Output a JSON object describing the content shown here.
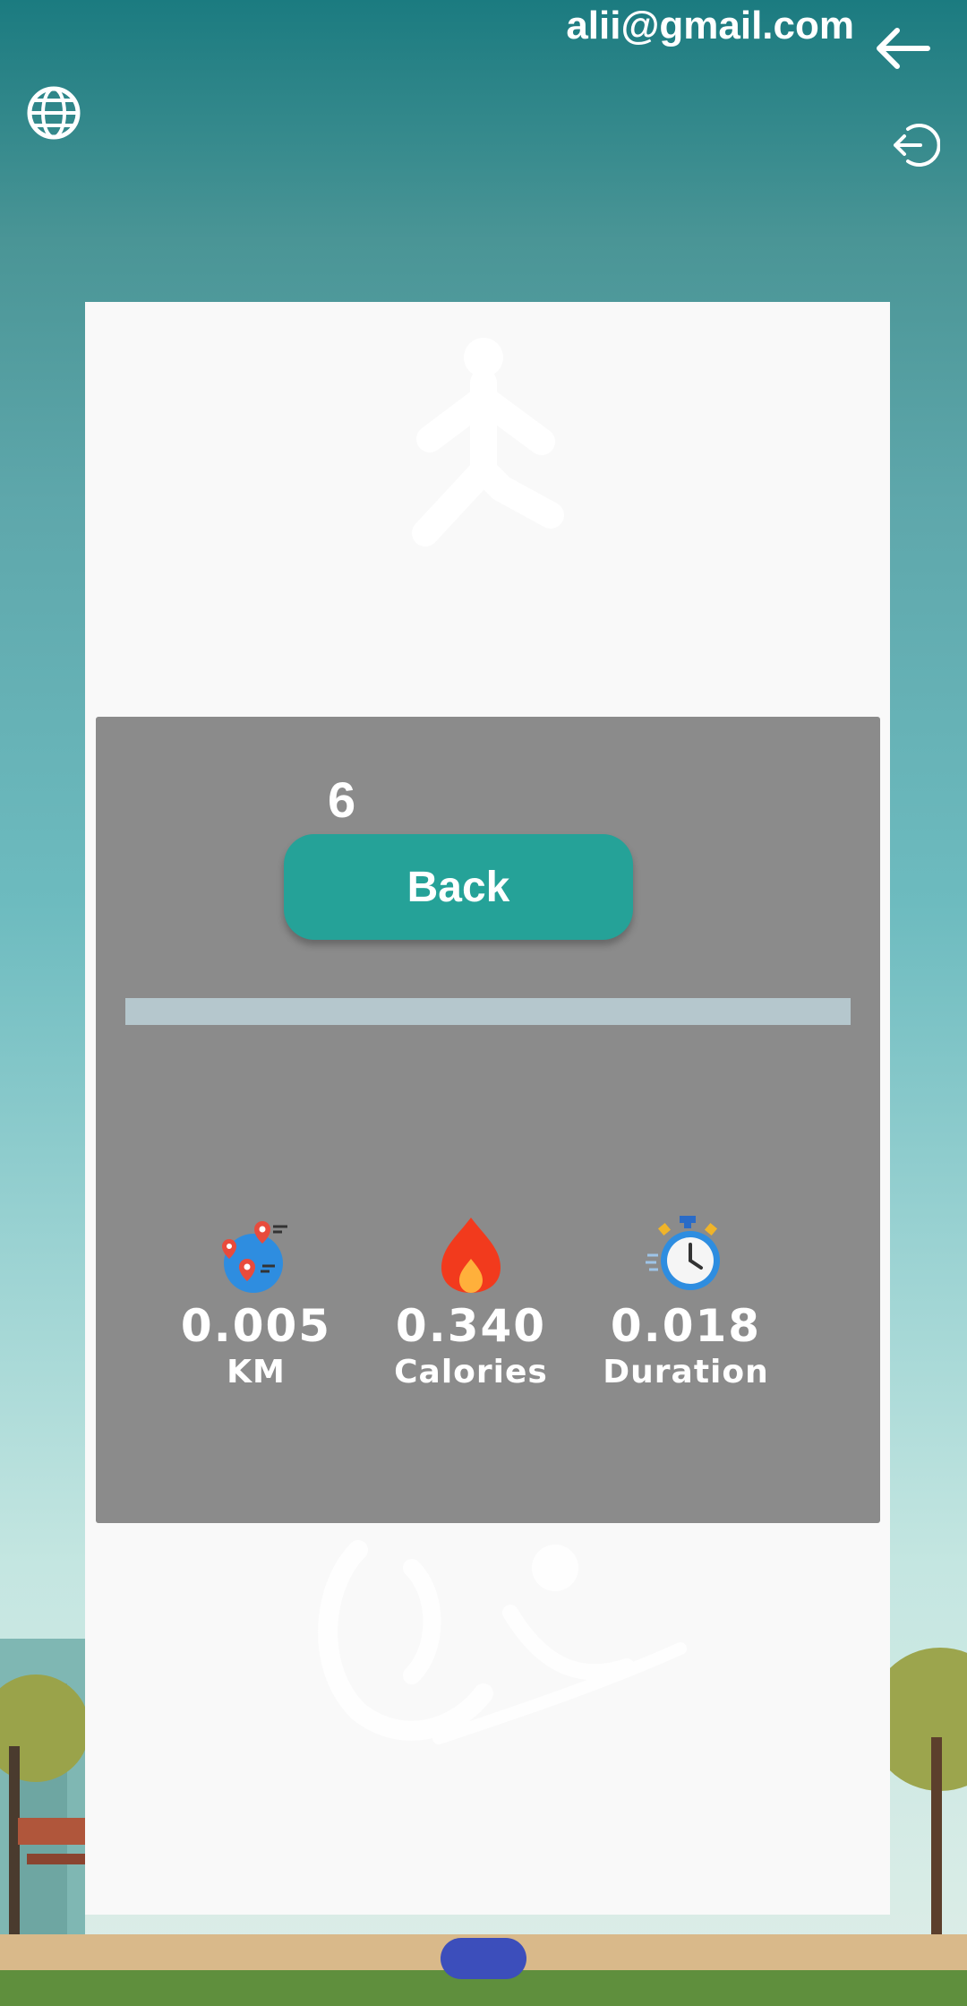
{
  "header": {
    "email": "alii@gmail.com"
  },
  "icons": {
    "top_back": "arrow-left-icon",
    "language": "globe-icon",
    "logout": "logout-icon",
    "walker": "walking-person-icon",
    "distance": "map-pins-icon",
    "calories": "flame-icon",
    "duration": "stopwatch-icon"
  },
  "session": {
    "count": "6",
    "back_label": "Back",
    "progress": 0
  },
  "stats": {
    "distance": {
      "value": "0.005",
      "label": "KM"
    },
    "calories": {
      "value": "0.340",
      "label": "Calories"
    },
    "duration": {
      "value": "0.018",
      "label": "Duration"
    }
  },
  "colors": {
    "accent": "#25a298",
    "panel": "#8b8b8b",
    "track": "#b5c7cd"
  }
}
